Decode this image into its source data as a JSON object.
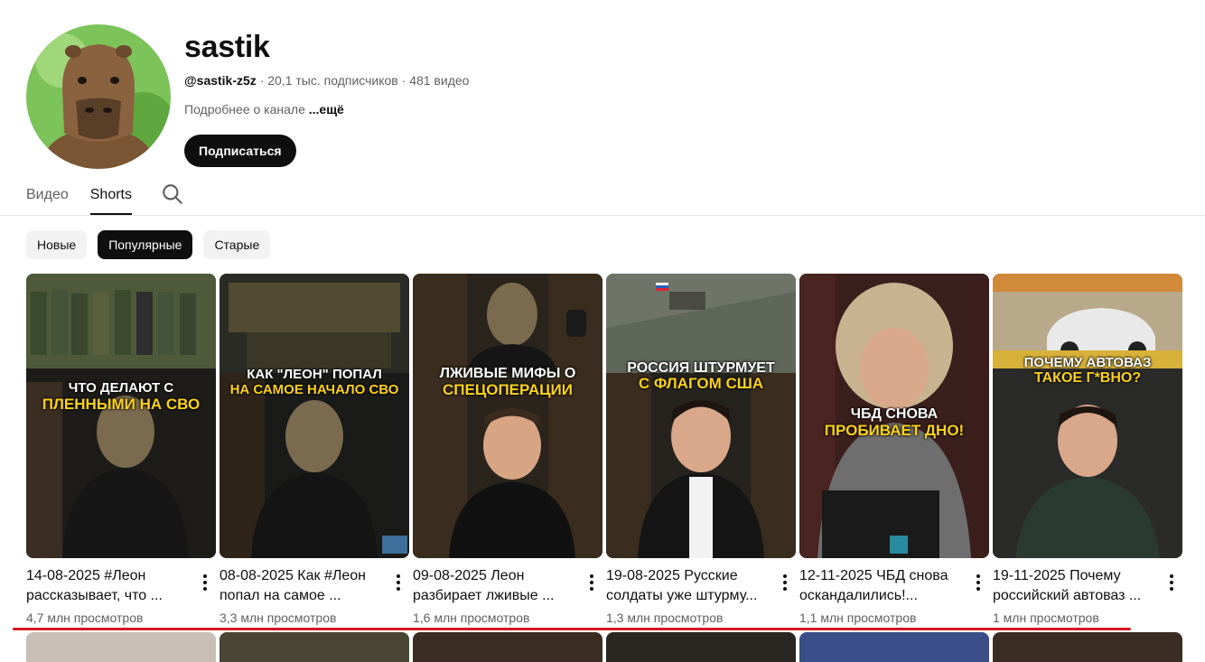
{
  "channel": {
    "name": "sastik",
    "handle": "@sastik-z5z",
    "subscribers": "20,1 тыс. подписчиков",
    "videos": "481 видео",
    "about": "Подробнее о канале",
    "more": "...ещё",
    "subscribe_label": "Подписаться",
    "avatar_icon": "capybara-avatar"
  },
  "tabs": [
    {
      "label": "Видео",
      "active": false
    },
    {
      "label": "Shorts",
      "active": true
    }
  ],
  "chips": [
    {
      "label": "Новые",
      "active": false
    },
    {
      "label": "Популярные",
      "active": true
    },
    {
      "label": "Старые",
      "active": false
    }
  ],
  "shorts": [
    {
      "title": "14-08-2025 #Леон рассказывает, что ...",
      "views": "4,7 млн просмотров",
      "overlay1": "ЧТО ДЕЛАЮТ С",
      "overlay2": "ПЛЕННЫМИ НА СВО"
    },
    {
      "title": "08-08-2025 Как #Леон попал на самое ...",
      "views": "3,3 млн просмотров",
      "overlay1": "КАК \"ЛЕОН\" ПОПАЛ",
      "overlay2": "НА САМОЕ НАЧАЛО СВО"
    },
    {
      "title": "09-08-2025 Леон разбирает лживые ...",
      "views": "1,6 млн просмотров",
      "overlay1": "ЛЖИВЫЕ МИФЫ О",
      "overlay2": "СПЕЦОПЕРАЦИИ"
    },
    {
      "title": "19-08-2025 Русские солдаты уже штурму...",
      "views": "1,3 млн просмотров",
      "overlay1": "РОССИЯ ШТУРМУЕТ",
      "overlay2": "С ФЛАГОМ США"
    },
    {
      "title": "12-11-2025 ЧБД снова оскандалились!...",
      "views": "1,1 млн просмотров",
      "overlay1": "ЧБД СНОВА",
      "overlay2": "ПРОБИВАЕТ ДНО!"
    },
    {
      "title": "19-11-2025 Почему российский автоваз ...",
      "views": "1 млн просмотров",
      "overlay1": "ПОЧЕМУ АВТОВАЗ",
      "overlay2": "ТАКОЕ Г*ВНО?"
    }
  ]
}
